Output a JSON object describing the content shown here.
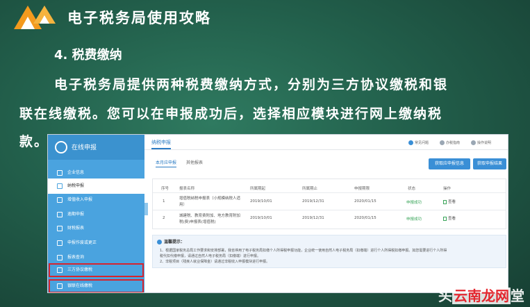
{
  "slide": {
    "title": "电子税务局使用攻略",
    "section": "4. 税费缴纳",
    "paragraph_lines": [
      "电子税务局提供两种税费缴纳方式，分别为三方协议缴税和银",
      "联在线缴税。您可以在申报成功后，选择相应模块进行网上缴纳税",
      "款。"
    ]
  },
  "app": {
    "sidebar": {
      "header": "在线申报",
      "items": [
        {
          "label": "企业信息",
          "icon": "info-icon"
        },
        {
          "label": "纳税申报",
          "icon": "doc-icon"
        },
        {
          "label": "增值收入申报",
          "icon": "doc-icon"
        },
        {
          "label": "逾期申报",
          "icon": "doc-icon"
        },
        {
          "label": "财税报表",
          "icon": "report-icon"
        },
        {
          "label": "申报作废或更正",
          "icon": "edit-icon"
        },
        {
          "label": "报表查询",
          "icon": "search-icon"
        },
        {
          "label": "三方协议缴税",
          "icon": "card-icon"
        },
        {
          "label": "银联在线缴税",
          "icon": "card-icon"
        }
      ]
    },
    "topbar": {
      "tab": "纳税申报",
      "links": [
        "常见问题",
        "办税指南",
        "操作说明"
      ]
    },
    "subtabs": [
      "本月应申报",
      "其他报表"
    ],
    "buttons": {
      "get_info": "获取应申报信息",
      "get_result": "获取申报结果"
    },
    "table": {
      "headers": [
        "序号",
        "报表名称",
        "所属期起",
        "所属期止",
        "申报期限",
        "状态",
        "操作"
      ],
      "rows": [
        {
          "no": "1",
          "name_lines": [
            "增值税纳税申报表（小规模纳税人适",
            "用）"
          ],
          "from": "2019/10/01",
          "to": "2019/12/31",
          "deadline": "2020/01/15",
          "status": "申报成功",
          "action": "查看"
        },
        {
          "no": "2",
          "name_lines": [
            "城建税、教育费附加、地方教育附加",
            "税(费)申报表(增值税)"
          ],
          "from": "2019/10/01",
          "to": "2019/12/31",
          "deadline": "2020/01/15",
          "status": "申报成功",
          "action": "查看"
        }
      ]
    },
    "notice": {
      "title": "温馨提示：",
      "lines": [
        "1、根据国家税务总局工作要求和安排部署，我省停用了电子税务局扣缴个人所得税申报功能，企业统一使用自然人电子税务局（扣缴端）进行个人所得税扣缴申报。如您需要进行个人所得",
        "税代扣代缴申报，请通过自然人电子税务局（扣缴端）进行申报。",
        "2、非税项目（残疾人就业保障金）请通过非税收入申报模块进行申报。"
      ]
    }
  },
  "watermark": {
    "prefix": "头",
    "main": "云南龙网",
    "suffix": "堂"
  },
  "colors": {
    "slide_bg": "#225f4b",
    "sidebar": "#4aa3df",
    "accent_blue": "#3a8fd6",
    "success_green": "#3aa55a",
    "highlight_red": "#d9232d"
  }
}
